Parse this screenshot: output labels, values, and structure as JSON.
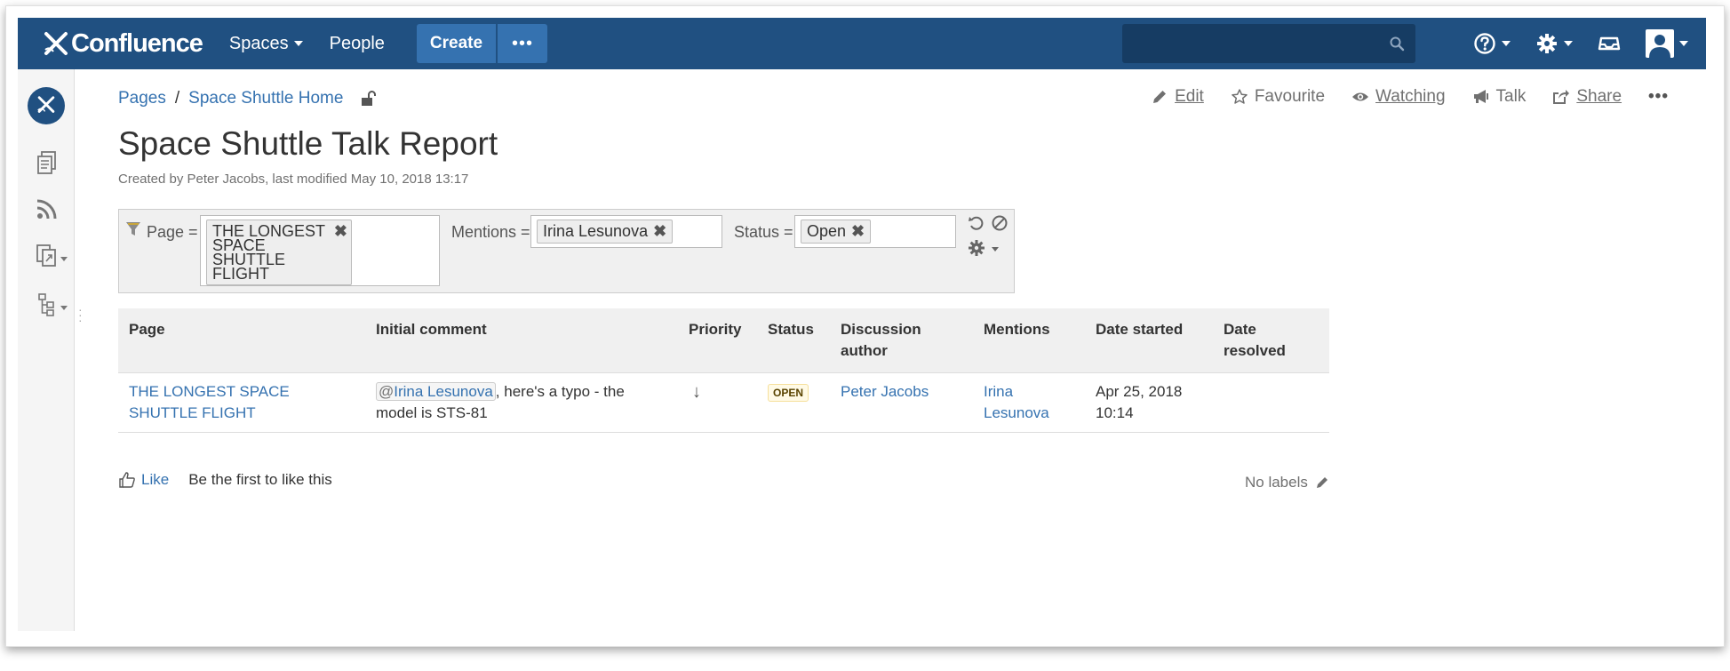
{
  "header": {
    "logo_text": "Confluence",
    "nav": {
      "spaces": "Spaces",
      "people": "People"
    },
    "create_label": "Create",
    "more_label": "•••",
    "search_placeholder": ""
  },
  "breadcrumb": {
    "items": [
      "Pages",
      "Space Shuttle Home"
    ],
    "separator": "/"
  },
  "page_actions": {
    "edit": "Edit",
    "favourite": "Favourite",
    "watching": "Watching",
    "talk": "Talk",
    "share": "Share",
    "more": "•••"
  },
  "page": {
    "title": "Space Shuttle Talk Report",
    "meta": "Created by Peter Jacobs, last modified May 10, 2018 13:17"
  },
  "filter": {
    "page_label": "Page =",
    "page_value_lines": [
      "THE LONGEST",
      "SPACE",
      "SHUTTLE",
      "FLIGHT"
    ],
    "mentions_label": "Mentions =",
    "mentions_value": "Irina Lesunova",
    "status_label": "Status =",
    "status_value": "Open",
    "remove_glyph": "✖"
  },
  "table": {
    "headers": {
      "page": "Page",
      "initial_comment": "Initial comment",
      "priority": "Priority",
      "status": "Status",
      "author_1": "Discussion",
      "author_2": "author",
      "mentions": "Mentions",
      "date_started": "Date started",
      "resolved_1": "Date",
      "resolved_2": "resolved"
    },
    "rows": [
      {
        "page_1": "THE LONGEST SPACE",
        "page_2": "SHUTTLE FLIGHT",
        "mention_at": "@",
        "mention_name": "Irina Lesunova",
        "comment_rest_1": ", here's a typo - the",
        "comment_rest_2": "model is STS-81",
        "priority": "↓",
        "status": "OPEN",
        "author": "Peter Jacobs",
        "mentions_1": "Irina",
        "mentions_2": "Lesunova",
        "date_started_1": "Apr 25, 2018",
        "date_started_2": "10:14",
        "date_resolved": ""
      }
    ]
  },
  "footer": {
    "like": "Like",
    "like_text": "Be the first to like this",
    "labels": "No labels"
  },
  "colors": {
    "header_bg": "#205081",
    "button_bg": "#3572b0",
    "link": "#3572b0",
    "search_bg": "#163c63"
  }
}
